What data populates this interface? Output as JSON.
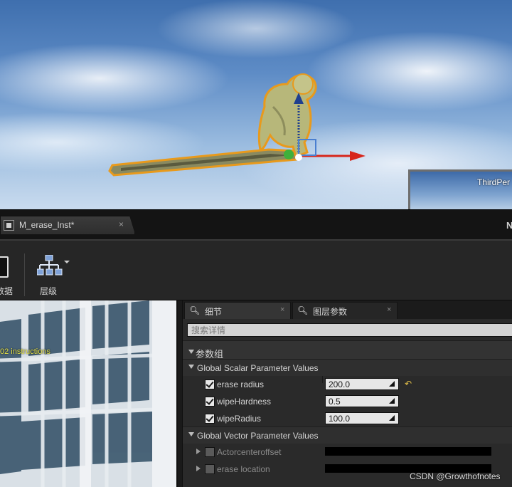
{
  "viewport": {
    "preview_label": "ThirdPer"
  },
  "tab": {
    "title": "M_erase_Inst*",
    "close": "×",
    "right_glyph": "N"
  },
  "toolbar": {
    "data_label": "数据",
    "layer_label": "层级"
  },
  "preview": {
    "instructions": "02 instructions"
  },
  "details": {
    "tabs": [
      {
        "icon": "magnifier-icon",
        "label": "细节",
        "close": "×"
      },
      {
        "icon": "magnifier-icon",
        "label": "图层参数",
        "close": "×"
      }
    ],
    "search_placeholder": "搜索详情",
    "parameter_group": "参数组",
    "scalar_section": "Global Scalar Parameter Values",
    "scalars": [
      {
        "name": "erase radius",
        "value": "200.0",
        "checked": true,
        "reset": "↶"
      },
      {
        "name": "wipeHardness",
        "value": "0.5",
        "checked": true
      },
      {
        "name": "wipeRadius",
        "value": "100.0",
        "checked": true
      }
    ],
    "vector_section": "Global Vector Parameter Values",
    "vectors": [
      {
        "name": "Actorcenteroffset",
        "color": "#000000",
        "checked": false
      },
      {
        "name": "erase location",
        "color": "#000000",
        "checked": false
      }
    ]
  },
  "watermark": "CSDN @Growthofnotes",
  "colors": {
    "selection_outline": "#e89a1c",
    "gizmo_x": "#d7261b",
    "gizmo_y": "#3fb03b",
    "gizmo_z": "#1f3f8f",
    "mesh": "#b7b77a"
  }
}
